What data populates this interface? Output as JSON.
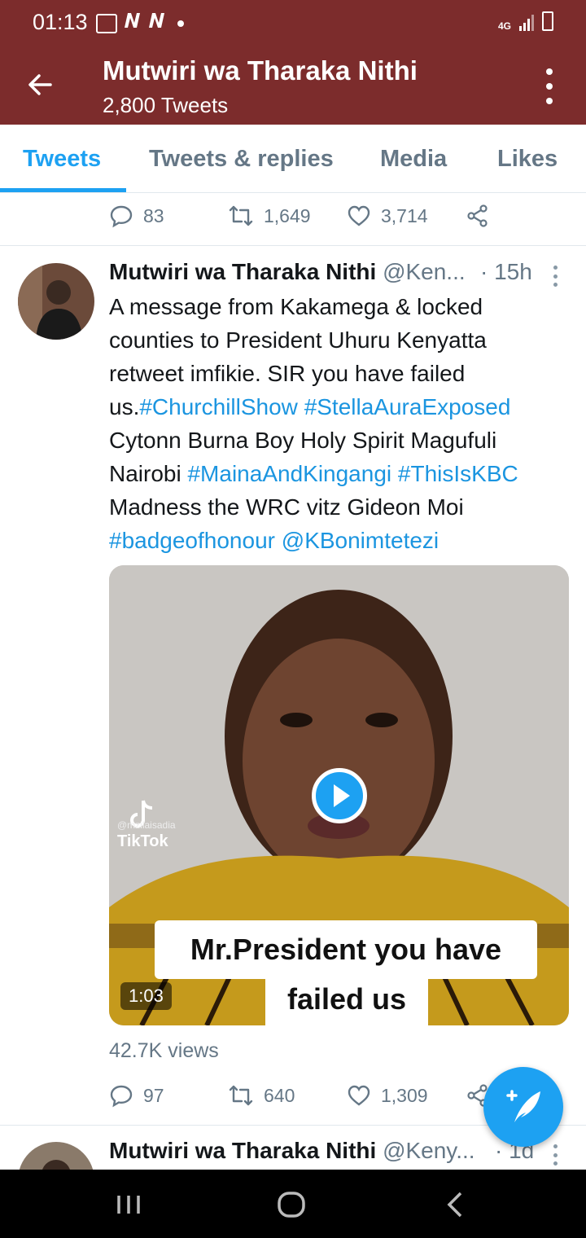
{
  "status_bar": {
    "time": "01:13",
    "left_icons": [
      "image-icon",
      "n-icon",
      "n-icon",
      "dot-icon"
    ],
    "network": "4G"
  },
  "header": {
    "back_icon": "arrow-left-icon",
    "title": "Mutwiri wa Tharaka Nithi",
    "subtitle": "2,800 Tweets",
    "menu_icon": "more-vertical-icon"
  },
  "tabs": [
    {
      "label": "Tweets",
      "active": true
    },
    {
      "label": "Tweets & replies",
      "active": false
    },
    {
      "label": "Media",
      "active": false
    },
    {
      "label": "Likes",
      "active": false
    }
  ],
  "previous_tweet_actions": {
    "replies": "83",
    "retweets": "1,649",
    "likes": "3,714"
  },
  "tweet": {
    "name": "Mutwiri wa Tharaka Nithi",
    "handle": "@Ken...",
    "time": "· 15h",
    "text_segments": [
      {
        "t": "A message from Kakamega & locked counties to President Uhuru Kenyatta retweet imfikie. SIR you have failed us.",
        "tag": false
      },
      {
        "t": "#ChurchillShow",
        "tag": true
      },
      {
        "t": " ",
        "tag": false
      },
      {
        "t": "#StellaAuraExposed",
        "tag": true
      },
      {
        "t": " Cytonn Burna Boy Holy Spirit Magufuli Nairobi ",
        "tag": false
      },
      {
        "t": "#MainaAndKingangi",
        "tag": true
      },
      {
        "t": " ",
        "tag": false
      },
      {
        "t": "#ThisIsKBC",
        "tag": true
      },
      {
        "t": " Madness the WRC vitz Gideon Moi ",
        "tag": false
      },
      {
        "t": "#badgeofhonour",
        "tag": true
      },
      {
        "t": " ",
        "tag": false
      },
      {
        "t": "@KBonimtetezi",
        "tag": true
      }
    ],
    "media": {
      "tiktok_label": "TikTok",
      "tiktok_user": "@mzilaisadia",
      "caption_line1": "Mr.President you have",
      "caption_line2": "failed us",
      "duration": "1:03"
    },
    "views": "42.7K views",
    "actions": {
      "replies": "97",
      "retweets": "640",
      "likes": "1,309"
    }
  },
  "next_tweet": {
    "name": "Mutwiri wa Tharaka Nithi",
    "handle": "@Keny...",
    "time": "· 1d"
  },
  "fab_icon": "compose-tweet-icon",
  "nav_bar": [
    "recent-apps-icon",
    "home-icon",
    "back-icon"
  ],
  "colors": {
    "header": "#7c2c2c",
    "accent": "#1da1f2",
    "secondary_text": "#657786"
  }
}
